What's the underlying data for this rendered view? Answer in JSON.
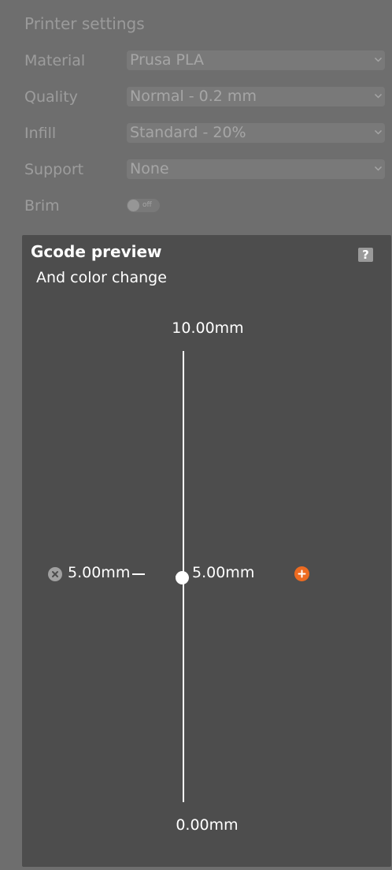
{
  "settings": {
    "title": "Printer settings",
    "rows": [
      {
        "label": "Material",
        "value": "Prusa PLA"
      },
      {
        "label": "Quality",
        "value": "Normal - 0.2 mm"
      },
      {
        "label": "Infill",
        "value": "Standard - 20%"
      },
      {
        "label": "Support",
        "value": "None"
      },
      {
        "label": "Brim",
        "toggle_text": "off",
        "toggle_on": false
      }
    ]
  },
  "preview": {
    "title": "Gcode preview",
    "help_label": "?",
    "subtitle": "And color change",
    "slider": {
      "max_label": "10.00mm",
      "min_label": "0.00mm",
      "current_label": "5.00mm",
      "max": 10.0,
      "min": 0.0,
      "current": 5.0
    },
    "color_change": {
      "label": "5.00mm",
      "height": 5.0
    },
    "colors": {
      "add_button": "#ed6b21",
      "remove_button": "#a0a0a0",
      "panel_background": "#4d4d4d"
    },
    "icons": {
      "help": "question-mark-icon",
      "remove": "close-icon",
      "add": "plus-icon"
    }
  }
}
